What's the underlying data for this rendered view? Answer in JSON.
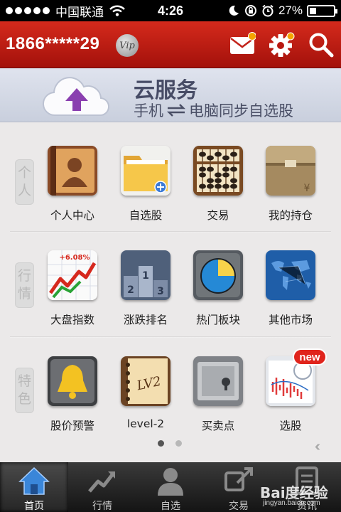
{
  "status_bar": {
    "carrier": "中国联通",
    "time": "4:26",
    "battery": "27%",
    "battery_level": 0.27,
    "signal_dots": 5
  },
  "header": {
    "phone": "1866*****29",
    "vip": "Vip",
    "icons": [
      "mail-icon",
      "gear-icon",
      "search-icon"
    ]
  },
  "banner": {
    "title": "云服务",
    "sub_left": "手机",
    "sub_right": "电脑同步自选股"
  },
  "sections": [
    {
      "label": "个人",
      "items": [
        "个人中心",
        "自选股",
        "交易",
        "我的持仓"
      ]
    },
    {
      "label": "行情",
      "items": [
        "大盘指数",
        "涨跌排名",
        "热门板块",
        "其他市场"
      ]
    },
    {
      "label": "特色",
      "items": [
        "股价预警",
        "level-2",
        "买卖点",
        "选股"
      ]
    }
  ],
  "tile_texts": {
    "index_change": "+6.08%",
    "lv2": "LV2",
    "new_badge": "new",
    "safe_symbol": "¥"
  },
  "pager": {
    "pages": 2,
    "current": 1
  },
  "tab_bar": {
    "tabs": [
      "首页",
      "行情",
      "自选",
      "交易",
      "资讯"
    ],
    "active": 0
  },
  "watermark": {
    "brand": "Bai度经验",
    "url": "jingyan.baidu.com"
  },
  "colors": {
    "header_red": "#c21d12",
    "new_badge": "#e0241c",
    "tab_active": "#3a86d9"
  }
}
